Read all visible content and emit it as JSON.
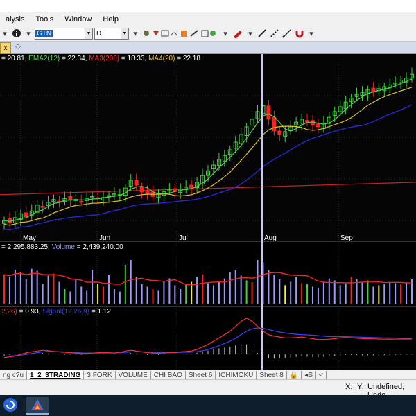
{
  "menu": [
    "alysis",
    "Tools",
    "Window",
    "Help"
  ],
  "toolbar": {
    "symbol": "GTN",
    "interval": "D",
    "icons": [
      "info-icon",
      "toolbar-tools-icon",
      "pencil-icon",
      "line-icon",
      "magnet-icon"
    ]
  },
  "chart_tab": {
    "label": "x"
  },
  "price_legend": [
    {
      "text": "= 20.81, ",
      "color": "#ffffff"
    },
    {
      "text": "EMA2(12)",
      "color": "#56d356"
    },
    {
      "text": " = 22.34, ",
      "color": "#ffffff"
    },
    {
      "text": "MA3(200)",
      "color": "#ff3030"
    },
    {
      "text": " = 18.33, ",
      "color": "#ffffff"
    },
    {
      "text": "MA4(20)",
      "color": "#f0c040"
    },
    {
      "text": " = 22.18",
      "color": "#ffffff"
    }
  ],
  "volume_legend": [
    {
      "text": "= 2,295,883.25, ",
      "color": "#ffffff"
    },
    {
      "text": "Volume",
      "color": "#9a9aff"
    },
    {
      "text": " = 2,439,240.00",
      "color": "#ffffff"
    }
  ],
  "macd_legend": [
    {
      "text": "2,26)",
      "color": "#ff3030"
    },
    {
      "text": " = 0.93, ",
      "color": "#ffffff"
    },
    {
      "text": "Signal(12,26,9)",
      "color": "#4040ff"
    },
    {
      "text": " = 1.12",
      "color": "#ffffff"
    }
  ],
  "months": [
    "May",
    "Jun",
    "Jul",
    "Aug",
    "Sep"
  ],
  "sheets": [
    "ng c?u",
    "1_2_3TRADING",
    "3 FORK",
    "VOLUME",
    "CHI BAO",
    "Sheet 6",
    "ICHIMOKU",
    "Sheet 8"
  ],
  "active_sheet": "1_2_3TRADING",
  "status": {
    "x": "X:",
    "y": "Y:",
    "text": "Undefined, Unde"
  },
  "colors": {
    "up": "#3ad33a",
    "down": "#ff2020",
    "ema": "#56d356",
    "ma20": "#e0c030",
    "ma200": "#cc2020",
    "slow": "#2828d0",
    "volume": "#9a9aff",
    "macd": "#ff3030",
    "signal": "#4040ff"
  },
  "chart_data": {
    "type": "candlestick",
    "x_ticks": [
      "May",
      "Jun",
      "Jul",
      "Aug",
      "Sep"
    ],
    "series": [
      {
        "name": "EMA2(12)",
        "last": 22.34
      },
      {
        "name": "MA3(200)",
        "last": 18.33
      },
      {
        "name": "MA4(20)",
        "last": 22.18
      },
      {
        "name": "Volume",
        "last": 2439240.0
      },
      {
        "name": "Signal(12,26,9)",
        "last": 1.12
      }
    ],
    "close": [
      15.6,
      15.4,
      15.9,
      16.3,
      16.0,
      16.6,
      17.2,
      17.0,
      17.5,
      17.8,
      17.6,
      17.9,
      17.7,
      17.8,
      17.6,
      17.9,
      18.1,
      17.9,
      18.0,
      18.2,
      18.4,
      18.3,
      19.0,
      19.8,
      19.3,
      18.6,
      18.4,
      18.1,
      18.4,
      18.6,
      18.8,
      18.7,
      18.9,
      19.1,
      19.0,
      19.6,
      20.3,
      20.8,
      21.4,
      22.0,
      22.4,
      23.0,
      23.8,
      24.6,
      25.4,
      26.2,
      27.0,
      27.6,
      26.2,
      25.0,
      24.6,
      24.9,
      25.4,
      25.9,
      26.2,
      25.9,
      25.6,
      25.4,
      25.8,
      26.4,
      27.0,
      27.5,
      28.0,
      28.4,
      28.8,
      29.0,
      29.3,
      29.1,
      29.4,
      29.6,
      29.8,
      30.0,
      30.3,
      30.5,
      30.9
    ],
    "volume": [
      60,
      55,
      70,
      65,
      50,
      72,
      68,
      40,
      58,
      62,
      45,
      30,
      25,
      50,
      35,
      28,
      70,
      40,
      35,
      60,
      30,
      25,
      80,
      90,
      55,
      40,
      35,
      30,
      28,
      45,
      52,
      38,
      30,
      40,
      45,
      55,
      60,
      42,
      38,
      47,
      52,
      65,
      70,
      58,
      48,
      44,
      90,
      85,
      70,
      60,
      50,
      38,
      45,
      55,
      42,
      40,
      35,
      33,
      45,
      52,
      48,
      38,
      40,
      55,
      50,
      45,
      48,
      35,
      38,
      40,
      45,
      42,
      40,
      44,
      50
    ],
    "macd": [
      -0.2,
      -0.15,
      -0.1,
      0.0,
      0.1,
      0.15,
      0.2,
      0.25,
      0.22,
      0.18,
      0.15,
      0.12,
      0.1,
      0.08,
      0.05,
      0.06,
      0.08,
      0.1,
      0.12,
      0.1,
      0.08,
      0.12,
      0.2,
      0.25,
      0.2,
      0.15,
      0.1,
      0.08,
      0.07,
      0.08,
      0.1,
      0.12,
      0.15,
      0.18,
      0.2,
      0.3,
      0.45,
      0.6,
      0.8,
      1.0,
      1.2,
      1.4,
      1.7,
      2.0,
      2.2,
      2.0,
      1.7,
      1.4,
      1.2,
      1.1,
      1.05,
      1.0,
      1.0,
      1.02,
      1.05,
      1.0,
      0.95,
      0.9,
      0.9,
      0.92,
      0.95,
      1.0,
      1.02,
      1.0,
      0.98,
      0.96,
      0.95,
      0.94,
      0.93,
      0.92,
      0.93,
      0.92,
      0.93,
      0.93,
      0.93
    ],
    "signal": [
      -0.1,
      -0.1,
      -0.08,
      -0.05,
      0.0,
      0.05,
      0.1,
      0.15,
      0.17,
      0.17,
      0.16,
      0.15,
      0.13,
      0.11,
      0.09,
      0.08,
      0.08,
      0.08,
      0.09,
      0.09,
      0.09,
      0.1,
      0.12,
      0.15,
      0.16,
      0.16,
      0.15,
      0.13,
      0.12,
      0.11,
      0.11,
      0.11,
      0.12,
      0.13,
      0.14,
      0.17,
      0.22,
      0.3,
      0.4,
      0.52,
      0.66,
      0.8,
      0.98,
      1.2,
      1.4,
      1.55,
      1.6,
      1.58,
      1.5,
      1.42,
      1.35,
      1.3,
      1.25,
      1.22,
      1.2,
      1.18,
      1.16,
      1.13,
      1.1,
      1.08,
      1.07,
      1.07,
      1.07,
      1.06,
      1.05,
      1.04,
      1.03,
      1.02,
      1.01,
      1.0,
      1.0,
      0.99,
      0.98,
      0.97,
      0.96
    ]
  }
}
